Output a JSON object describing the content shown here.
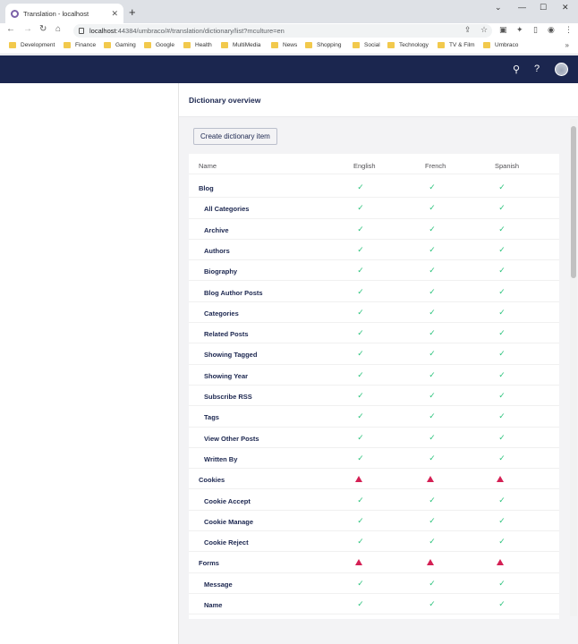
{
  "browser": {
    "tab_title": "Translation - localhost",
    "url_host": "localhost",
    "url_path": ":44384/umbraco/#/translation/dictionary/list?mculture=en",
    "bookmarks": [
      "Development",
      "Finance",
      "Gaming",
      "Google",
      "Health",
      "MultiMedia",
      "News",
      "Shopping",
      "Social",
      "Technology",
      "TV & Film",
      "Umbraco"
    ]
  },
  "page": {
    "title": "Dictionary overview",
    "create_button": "Create dictionary item"
  },
  "table": {
    "columns": [
      "Name",
      "English",
      "French",
      "Spanish"
    ],
    "rows": [
      {
        "name": "Blog",
        "indent": 0,
        "status": [
          "ok",
          "ok",
          "ok"
        ]
      },
      {
        "name": "All Categories",
        "indent": 1,
        "status": [
          "ok",
          "ok",
          "ok"
        ]
      },
      {
        "name": "Archive",
        "indent": 1,
        "status": [
          "ok",
          "ok",
          "ok"
        ]
      },
      {
        "name": "Authors",
        "indent": 1,
        "status": [
          "ok",
          "ok",
          "ok"
        ]
      },
      {
        "name": "Biography",
        "indent": 1,
        "status": [
          "ok",
          "ok",
          "ok"
        ]
      },
      {
        "name": "Blog Author Posts",
        "indent": 1,
        "status": [
          "ok",
          "ok",
          "ok"
        ]
      },
      {
        "name": "Categories",
        "indent": 1,
        "status": [
          "ok",
          "ok",
          "ok"
        ]
      },
      {
        "name": "Related Posts",
        "indent": 1,
        "status": [
          "ok",
          "ok",
          "ok"
        ]
      },
      {
        "name": "Showing Tagged",
        "indent": 1,
        "status": [
          "ok",
          "ok",
          "ok"
        ]
      },
      {
        "name": "Showing Year",
        "indent": 1,
        "status": [
          "ok",
          "ok",
          "ok"
        ]
      },
      {
        "name": "Subscribe RSS",
        "indent": 1,
        "status": [
          "ok",
          "ok",
          "ok"
        ]
      },
      {
        "name": "Tags",
        "indent": 1,
        "status": [
          "ok",
          "ok",
          "ok"
        ]
      },
      {
        "name": "View Other Posts",
        "indent": 1,
        "status": [
          "ok",
          "ok",
          "ok"
        ]
      },
      {
        "name": "Written By",
        "indent": 1,
        "status": [
          "ok",
          "ok",
          "ok"
        ]
      },
      {
        "name": "Cookies",
        "indent": 0,
        "status": [
          "warn",
          "warn",
          "warn"
        ]
      },
      {
        "name": "Cookie Accept",
        "indent": 1,
        "status": [
          "ok",
          "ok",
          "ok"
        ]
      },
      {
        "name": "Cookie Manage",
        "indent": 1,
        "status": [
          "ok",
          "ok",
          "ok"
        ]
      },
      {
        "name": "Cookie Reject",
        "indent": 1,
        "status": [
          "ok",
          "ok",
          "ok"
        ]
      },
      {
        "name": "Forms",
        "indent": 0,
        "status": [
          "warn",
          "warn",
          "warn"
        ]
      },
      {
        "name": "Message",
        "indent": 1,
        "status": [
          "ok",
          "ok",
          "ok"
        ]
      },
      {
        "name": "Name",
        "indent": 1,
        "status": [
          "ok",
          "ok",
          "ok"
        ]
      }
    ]
  },
  "colors": {
    "header": "#1b264f",
    "ok": "#2bc37c",
    "warn": "#d42054"
  },
  "icons": {
    "ok": "check-icon",
    "warn": "warning-icon"
  }
}
